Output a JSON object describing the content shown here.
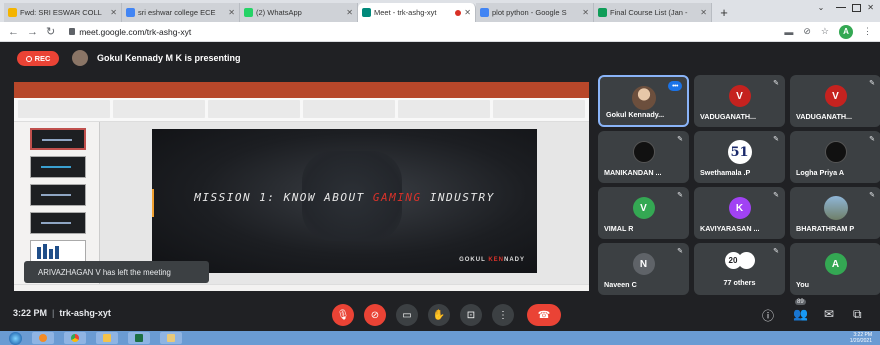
{
  "browser": {
    "tabs": [
      {
        "title": "Fwd: SRI ESWAR COLL",
        "color": "#f4b400",
        "active": false
      },
      {
        "title": "sri eshwar college ECE",
        "color": "#4285f4",
        "active": false
      },
      {
        "title": "(2) WhatsApp",
        "color": "#25d366",
        "active": false
      },
      {
        "title": "Meet - trk-ashg-xyt",
        "color": "#00897b",
        "active": true
      },
      {
        "title": "plot python - Google S",
        "color": "#4285f4",
        "active": false
      },
      {
        "title": "Final Course List (Jan -",
        "color": "#0f9d58",
        "active": false
      }
    ],
    "url": "meet.google.com/trk-ashg-xyt",
    "profile_initial": "A"
  },
  "meet": {
    "rec_label": "REC",
    "presenting_text": "Gokul Kennady M K is presenting",
    "toast": "ARIVAZHAGAN V has left the meeting",
    "time": "3:22 PM",
    "meeting_code": "trk-ashg-xyt",
    "participants": [
      {
        "name": "Gokul Kennady...",
        "kind": "photo",
        "active": true
      },
      {
        "name": "VADUGANATH...",
        "kind": "initial",
        "initial": "V",
        "color": "#c5221f"
      },
      {
        "name": "VADUGANATH...",
        "kind": "initial",
        "initial": "V",
        "color": "#c5221f"
      },
      {
        "name": "MANIKANDAN ...",
        "kind": "dark"
      },
      {
        "name": "Swethamala .P",
        "kind": "logo",
        "text": "51"
      },
      {
        "name": "Logha Priya A",
        "kind": "dark"
      },
      {
        "name": "VIMAL R",
        "kind": "initial",
        "initial": "V",
        "color": "#34a853"
      },
      {
        "name": "KAVIYARASAN ...",
        "kind": "initial",
        "initial": "K",
        "color": "#a142f4"
      },
      {
        "name": "BHARATHRAM P",
        "kind": "scene"
      },
      {
        "name": "Naveen C",
        "kind": "initial",
        "initial": "N",
        "color": "#5f6368"
      },
      {
        "name": "77 others",
        "kind": "others",
        "count": "20"
      },
      {
        "name": "You",
        "kind": "initial",
        "initial": "A",
        "color": "#34a853"
      }
    ],
    "participants_badge": "89"
  },
  "slide": {
    "title_part1": "MISSION 1: KNOW ABOUT ",
    "title_red": "GAMING",
    "title_part2": " INDUSTRY",
    "author_part1": "GOKUL ",
    "author_red": "KEN",
    "author_part2": "NADY"
  },
  "taskbar": {
    "time": "3:22 PM",
    "date": "1/20/2021"
  }
}
